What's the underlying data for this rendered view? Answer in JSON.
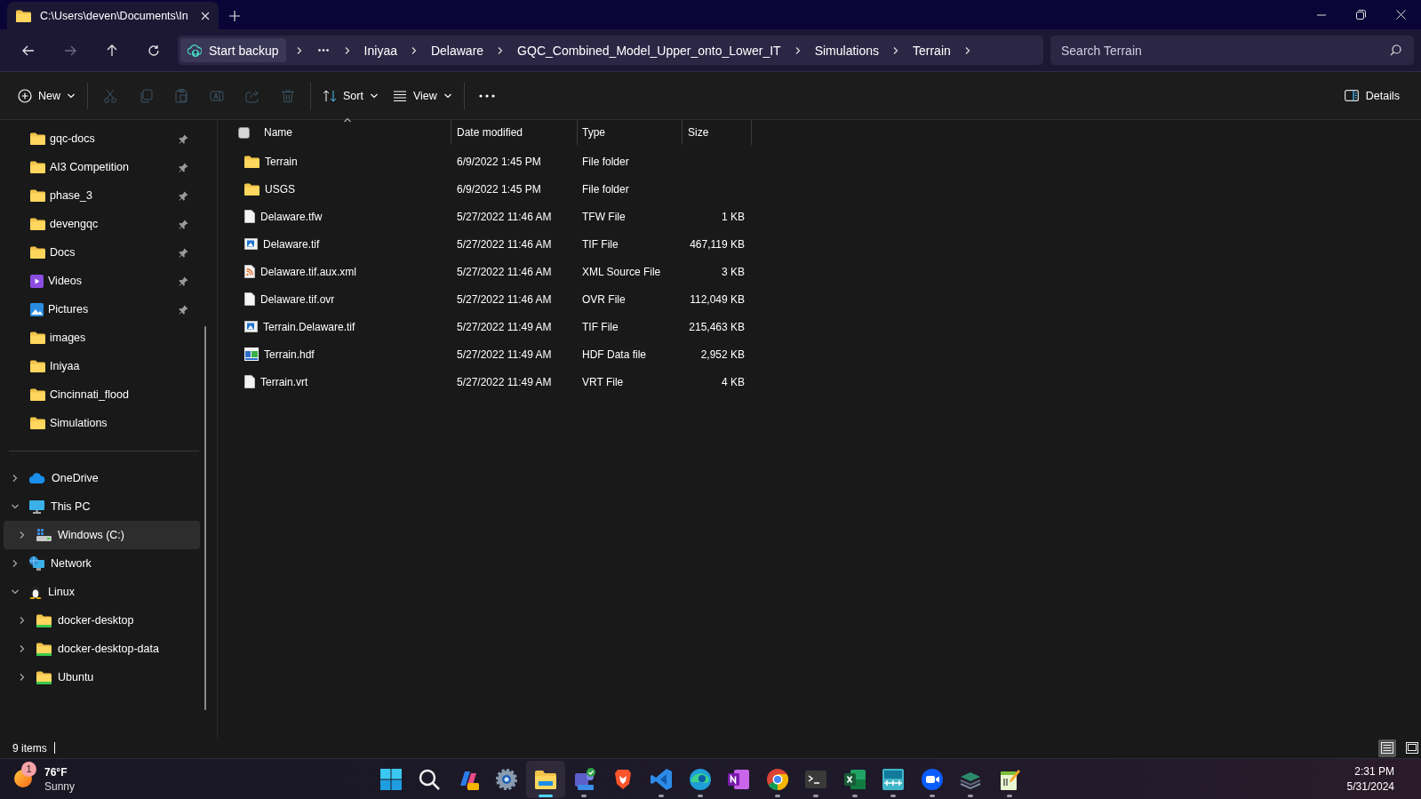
{
  "window": {
    "tab_title": "C:\\Users\\deven\\Documents\\In"
  },
  "address_bar": {
    "forward_disabled": true,
    "backup_label": "Start backup",
    "crumbs": [
      "Iniyaa",
      "Delaware",
      "GQC_Combined_Model_Upper_onto_Lower_IT",
      "Simulations",
      "Terrain"
    ],
    "search_placeholder": "Search Terrain"
  },
  "toolbar": {
    "items": [
      {
        "kind": "new",
        "label": "New",
        "disabled": false
      },
      {
        "kind": "cut",
        "disabled": true
      },
      {
        "kind": "copy",
        "disabled": true
      },
      {
        "kind": "paste",
        "disabled": true
      },
      {
        "kind": "rename",
        "disabled": true
      },
      {
        "kind": "share",
        "disabled": true
      },
      {
        "kind": "delete",
        "disabled": true
      },
      {
        "kind": "sort",
        "label": "Sort",
        "disabled": false
      },
      {
        "kind": "view",
        "label": "View",
        "disabled": false
      },
      {
        "kind": "more",
        "disabled": false
      }
    ],
    "details_label": "Details"
  },
  "sidebar": {
    "quick_access": [
      {
        "label": "gqc-docs",
        "kind": "folder",
        "pinned": true
      },
      {
        "label": "AI3 Competition",
        "kind": "folder",
        "pinned": true
      },
      {
        "label": "phase_3",
        "kind": "folder",
        "pinned": true
      },
      {
        "label": "devengqc",
        "kind": "folder",
        "pinned": true
      },
      {
        "label": "Docs",
        "kind": "folder",
        "pinned": true
      },
      {
        "label": "Videos",
        "kind": "videos",
        "pinned": true
      },
      {
        "label": "Pictures",
        "kind": "pictures",
        "pinned": true
      },
      {
        "label": "images",
        "kind": "folder",
        "pinned": false
      },
      {
        "label": "Iniyaa",
        "kind": "folder",
        "pinned": false
      },
      {
        "label": "Cincinnati_flood",
        "kind": "folder",
        "pinned": false
      },
      {
        "label": "Simulations",
        "kind": "folder",
        "pinned": false
      }
    ],
    "tree": [
      {
        "label": "OneDrive",
        "kind": "cloud",
        "expanded": false,
        "selected": false
      },
      {
        "label": "This PC",
        "kind": "pc",
        "expanded": true,
        "selected": false,
        "children": [
          {
            "label": "Windows (C:)",
            "kind": "drive",
            "expanded": false,
            "selected": true
          }
        ]
      },
      {
        "label": "Network",
        "kind": "network",
        "expanded": false,
        "selected": false
      },
      {
        "label": "Linux",
        "kind": "linux",
        "expanded": true,
        "selected": false,
        "children": [
          {
            "label": "docker-desktop",
            "kind": "linux-folder",
            "expanded": false,
            "selected": false
          },
          {
            "label": "docker-desktop-data",
            "kind": "linux-folder",
            "expanded": false,
            "selected": false
          },
          {
            "label": "Ubuntu",
            "kind": "linux-folder",
            "expanded": false,
            "selected": false
          }
        ]
      }
    ]
  },
  "table": {
    "select_all_checked": false,
    "columns": [
      {
        "label": "Name",
        "sorted": true
      },
      {
        "label": "Date modified",
        "sorted": false
      },
      {
        "label": "Type",
        "sorted": false
      },
      {
        "label": "Size",
        "sorted": false
      }
    ],
    "rows": [
      {
        "kind": "folder",
        "name": "Terrain",
        "date": "6/9/2022 1:45 PM",
        "type": "File folder"
      },
      {
        "kind": "folder",
        "name": "USGS",
        "date": "6/9/2022 1:45 PM",
        "type": "File folder"
      },
      {
        "kind": "file",
        "name": "Delaware.tfw",
        "date": "5/27/2022 11:46 AM",
        "type": "TFW File",
        "size": "1 KB"
      },
      {
        "kind": "image",
        "name": "Delaware.tif",
        "date": "5/27/2022 11:46 AM",
        "type": "TIF File",
        "size": "467,119 KB"
      },
      {
        "kind": "xml",
        "name": "Delaware.tif.aux.xml",
        "date": "5/27/2022 11:46 AM",
        "type": "XML Source File",
        "size": "3 KB"
      },
      {
        "kind": "file",
        "name": "Delaware.tif.ovr",
        "date": "5/27/2022 11:46 AM",
        "type": "OVR File",
        "size": "112,049 KB"
      },
      {
        "kind": "image",
        "name": "Terrain.Delaware.tif",
        "date": "5/27/2022 11:49 AM",
        "type": "TIF File",
        "size": "215,463 KB"
      },
      {
        "kind": "hdf",
        "name": "Terrain.hdf",
        "date": "5/27/2022 11:49 AM",
        "type": "HDF Data file",
        "size": "2,952 KB"
      },
      {
        "kind": "file",
        "name": "Terrain.vrt",
        "date": "5/27/2022 11:49 AM",
        "type": "VRT File",
        "size": "4 KB"
      }
    ]
  },
  "status_bar": {
    "count": "9 items",
    "views": [
      {
        "kind": "details",
        "selected": true
      },
      {
        "kind": "tiles",
        "selected": false
      }
    ]
  },
  "taskbar": {
    "weather": {
      "temperature": "76°F",
      "condition": "Sunny",
      "badge": "1"
    },
    "apps": [
      {
        "kind": "start",
        "running": false,
        "selected": false
      },
      {
        "kind": "search",
        "running": false,
        "selected": false
      },
      {
        "kind": "copilot",
        "running": false,
        "selected": false
      },
      {
        "kind": "settings",
        "running": false,
        "selected": false
      },
      {
        "kind": "explorer",
        "running": true,
        "selected": true
      },
      {
        "kind": "teams",
        "running": true,
        "selected": false
      },
      {
        "kind": "brave",
        "running": false,
        "selected": false
      },
      {
        "kind": "vscode",
        "running": true,
        "selected": false
      },
      {
        "kind": "edge",
        "running": true,
        "selected": false
      },
      {
        "kind": "onenote",
        "running": false,
        "selected": false
      },
      {
        "kind": "chrome",
        "running": true,
        "selected": false
      },
      {
        "kind": "terminal",
        "running": true,
        "selected": false
      },
      {
        "kind": "excel",
        "running": true,
        "selected": false
      },
      {
        "kind": "ras",
        "running": true,
        "selected": false
      },
      {
        "kind": "zoom",
        "running": true,
        "selected": false
      },
      {
        "kind": "layers",
        "running": true,
        "selected": false
      },
      {
        "kind": "notepad",
        "running": true,
        "selected": false
      }
    ],
    "time": "2:31 PM",
    "date": "5/31/2024"
  }
}
